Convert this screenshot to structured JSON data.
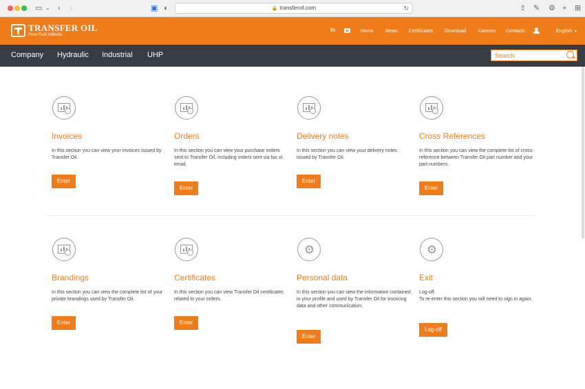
{
  "browser": {
    "url": "transferoil.com"
  },
  "header": {
    "logo_title": "TRANSFER OIL",
    "logo_tagline": "Pure Fluid Attitude",
    "linkedin_label": "in",
    "nav": [
      "Home",
      "News",
      "Certificates",
      "Download",
      "Careers",
      "Contacts"
    ],
    "language": "English"
  },
  "main_nav": {
    "items": [
      "Company",
      "Hydraulic",
      "Industrial",
      "UHP"
    ],
    "search_placeholder": "Search"
  },
  "colors": {
    "accent": "#f07d1a",
    "nav_bg": "#363d42"
  },
  "cards": [
    {
      "title": "Invoices",
      "desc": "In this section you can view your invoices issued by Transfer Oil.",
      "button": "Enter",
      "icon": "document-chart-icon"
    },
    {
      "title": "Orders",
      "desc": "In this section you can view your purchase orders sent to Transfer Oil, including orders sent via fax or email.",
      "button": "Enter",
      "icon": "document-chart-icon"
    },
    {
      "title": "Delivery notes",
      "desc": "In this section you can view your delivery notes issued by Transfer Oil.",
      "button": "Enter",
      "icon": "document-chart-icon"
    },
    {
      "title": "Cross References",
      "desc": "In this section you can view the complete list of cross- reference between Transfer Oil part number and your part numbers.",
      "button": "Enter",
      "icon": "document-chart-icon"
    },
    {
      "title": "Brandings",
      "desc": "In this section you can view the complete list of your private brandings used by Transfer Oil.",
      "button": "Enter",
      "icon": "document-chart-icon"
    },
    {
      "title": "Certificates",
      "desc": "In this section you can view Transfer Oil certificates related to your orders.",
      "button": "Enter",
      "icon": "document-chart-icon"
    },
    {
      "title": "Personal data",
      "desc": "In this section you can view the information contained in your profile and used by Transfer Oil for invoicing data and other communication.",
      "button": "Enter",
      "icon": "gear-icon"
    },
    {
      "title": "Exit",
      "desc": "Log-off.",
      "desc2": "To re-enter this section you will need to sign in again.",
      "button": "Log-off",
      "icon": "gear-icon"
    }
  ]
}
